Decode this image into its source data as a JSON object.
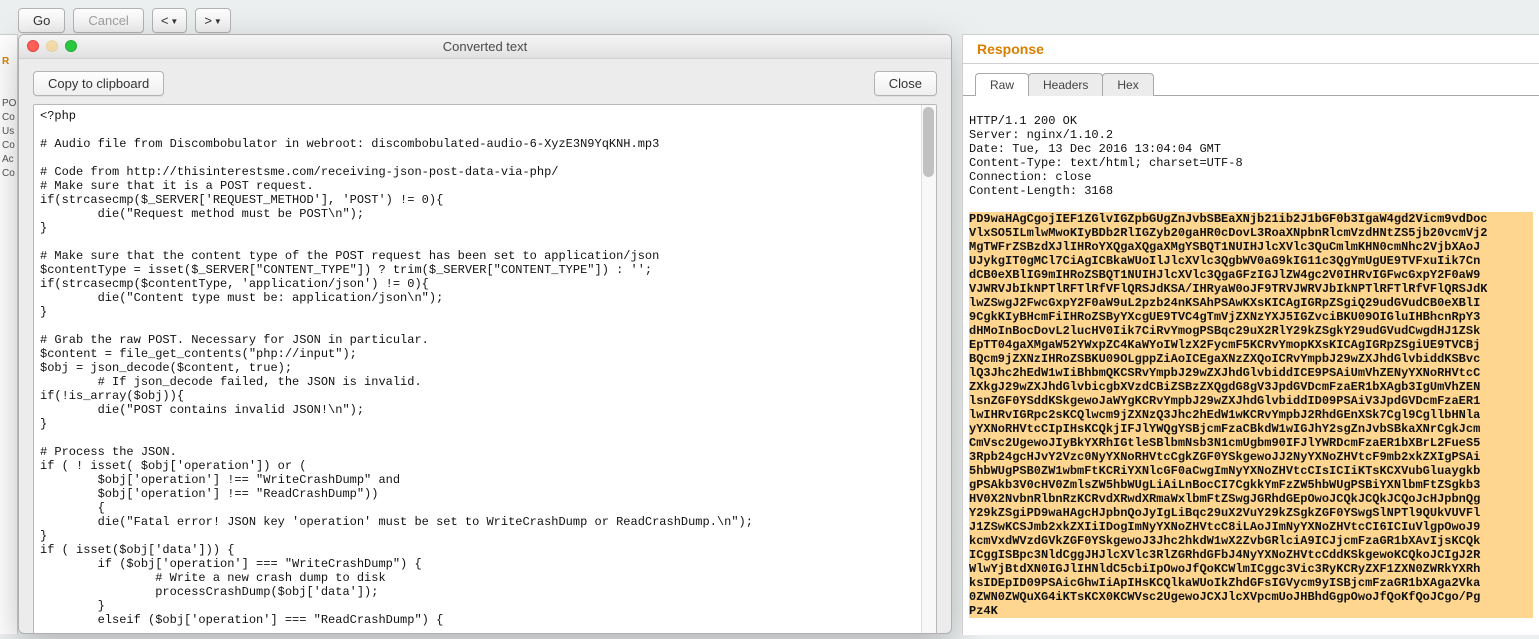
{
  "toolbar": {
    "go_label": "Go",
    "cancel_label": "Cancel",
    "prev_label": "<",
    "next_label": ">"
  },
  "left_gutter": {
    "header": "R",
    "lines": "PO\nCo\nUs\nCo\nAc\nCo"
  },
  "dialog": {
    "title": "Converted text",
    "copy_label": "Copy to clipboard",
    "close_label": "Close",
    "code": "<?php\n\n# Audio file from Discombobulator in webroot: discombobulated-audio-6-XyzE3N9YqKNH.mp3\n\n# Code from http://thisinterestsme.com/receiving-json-post-data-via-php/\n# Make sure that it is a POST request.\nif(strcasecmp($_SERVER['REQUEST_METHOD'], 'POST') != 0){\n        die(\"Request method must be POST\\n\");\n}\n\n# Make sure that the content type of the POST request has been set to application/json\n$contentType = isset($_SERVER[\"CONTENT_TYPE\"]) ? trim($_SERVER[\"CONTENT_TYPE\"]) : '';\nif(strcasecmp($contentType, 'application/json') != 0){\n        die(\"Content type must be: application/json\\n\");\n}\n\n# Grab the raw POST. Necessary for JSON in particular.\n$content = file_get_contents(\"php://input\");\n$obj = json_decode($content, true);\n        # If json_decode failed, the JSON is invalid.\nif(!is_array($obj)){\n        die(\"POST contains invalid JSON!\\n\");\n}\n\n# Process the JSON.\nif ( ! isset( $obj['operation']) or (\n        $obj['operation'] !== \"WriteCrashDump\" and\n        $obj['operation'] !== \"ReadCrashDump\"))\n        {\n        die(\"Fatal error! JSON key 'operation' must be set to WriteCrashDump or ReadCrashDump.\\n\");\n}\nif ( isset($obj['data'])) {\n        if ($obj['operation'] === \"WriteCrashDump\") {\n                # Write a new crash dump to disk\n                processCrashDump($obj['data']);\n        }\n        elseif ($obj['operation'] === \"ReadCrashDump\") {"
  },
  "response": {
    "header": "Response",
    "tabs": {
      "raw": "Raw",
      "headers": "Headers",
      "hex": "Hex"
    },
    "http_headers": "HTTP/1.1 200 OK\nServer: nginx/1.10.2\nDate: Tue, 13 Dec 2016 13:04:04 GMT\nContent-Type: text/html; charset=UTF-8\nConnection: close\nContent-Length: 3168",
    "body_lines": [
      "PD9waHAgCgojIEF1ZGlvIGZpbGUgZnJvbSBEaXNjb21ib2J1bGF0b3IgaW4gd2Vicm9vdDoc",
      "VlxSO5ILmlwMwoKIyBDb2RlIGZyb20gaHR0cDovL3RoaXNpbnRlcmVzdHNtZS5jb20vcmVj2",
      "MgTWFrZSBzdXJlIHRoYXQgaXQgaXMgYSBQT1NUIHJlcXVlc3QuCmlmKHN0cmNhc2VjbXAoJ",
      "UJykgIT0gMCl7CiAgICBkaWUoIlJlcXVlc3QgbWV0aG9kIG11c3QgYmUgUE9TVFxuIik7Cn",
      "dCB0eXBlIG9mIHRoZSBQT1NUIHJlcXVlc3QgaGFzIGJlZW4gc2V0IHRvIGFwcGxpY2F0aW9",
      "VJWRVJbIkNPTlRFTlRfVFlQRSJdKSA/IHRyaW0oJF9TRVJWRVJbIkNPTlRFTlRfVFlQRSJdK",
      "lwZSwgJ2FwcGxpY2F0aW9uL2pzb24nKSAhPSAwKXsKICAgIGRpZSgiQ29udGVudCB0eXBlI",
      "9CgkKIyBHcmFiIHRoZSByYXcgUE9TVC4gTmVjZXNzYXJ5IGZvciBKU09OIGluIHBhcnRpY3",
      "dHMoInBocDovL2lucHV0Iik7CiRvYmogPSBqc29uX2RlY29kZSgkY29udGVudCwgdHJ1ZSk",
      "EpTT04gaXMgaW52YWxpZC4KaWYoIWlzX2FycmF5KCRvYmopKXsKICAgIGRpZSgiUE9TVCBj",
      "BQcm9jZXNzIHRoZSBKU09OLgppZiAoICEgaXNzZXQoICRvYmpbJ29wZXJhdGlvbiddKSBvc",
      "lQ3Jhc2hEdW1wIiBhbmQKCSRvYmpbJ29wZXJhdGlvbiddICE9PSAiUmVhZENyYXNoRHVtcC",
      "ZXkgJ29wZXJhdGlvbicgbXVzdCBiZSBzZXQgdG8gV3JpdGVDcmFzaER1bXAgb3IgUmVhZEN",
      "lsnZGF0YSddKSkgewoJaWYgKCRvYmpbJ29wZXJhdGlvbiddID09PSAiV3JpdGVDcmFzaER1",
      "lwIHRvIGRpc2sKCQlwcm9jZXNzQ3Jhc2hEdW1wKCRvYmpbJ2RhdGEnXSk7Cgl9CgllbHNla",
      "yYXNoRHVtcCIpIHsKCQkjIFJlYWQgYSBjcmFzaCBkdW1wIGJhY2sgZnJvbSBkaXNrCgkJcm",
      "CmVsc2UgewoJIyBkYXRhIGtleSBlbmNsb3N1cmUgbm90IFJlYWRDcmFzaER1bXBrL2FueS5",
      "3Rpb24gcHJvY2Vzc0NyYXNoRHVtcCgkZGF0YSkgewoJJ2NyYXNoZHVtcF9mb2xkZXIgPSAi",
      "5hbWUgPSB0ZW1wbmFtKCRiYXNlcGF0aCwgImNyYXNoZHVtcCIsICIiKTsKCXVubGluaygkb",
      "gPSAkb3V0cHV0ZmlsZW5hbWUgLiAiLnBocCI7CgkkYmFzZW5hbWUgPSBiYXNlbmFtZSgkb3",
      "HV0X2NvbnRlbnRzKCRvdXRwdXRmaWxlbmFtZSwgJGRhdGEpOwoJCQkJCQkJCQoJcHJpbnQg",
      "Y29kZSgiPD9waHAgcHJpbnQoJyIgLiBqc29uX2VuY29kZSgkZGF0YSwgSlNPTl9QUkVUVFl",
      "J1ZSwKCSJmb2xkZXIiIDogImNyYXNoZHVtcC8iLAoJImNyYXNoZHVtcCI6ICIuVlgpOwoJ9",
      "kcmVxdWVzdGVkZGF0YSkgewoJ3Jhc2hkdW1wX2ZvbGRlciA9ICJjcmFzaGR1bXAvIjsKCQk",
      "ICggISBpc3NldCggJHJlcXVlc3RlZGRhdGFbJ4NyYXNoZHVtcCddKSkgewoKCQkoJCIgJ2R",
      "WlwYjBtdXN0IGJlIHNldC5cbiIpOwoJfQoKCWlmICggc3Vic3RyKCRyZXF1ZXN0ZWRkYXRh",
      "ksIDEpID09PSAicGhwIiApIHsKCQlkaWUoIkZhdGFsIGVycm9yISBjcmFzaGR1bXAga2Vka",
      "0ZWN0ZWQuXG4iKTsKCX0KCWVsc2UgewoJCXJlcXVpcmUoJHBhdGgpOwoJfQoKfQoJCgo/Pg",
      "Pz4K"
    ]
  }
}
